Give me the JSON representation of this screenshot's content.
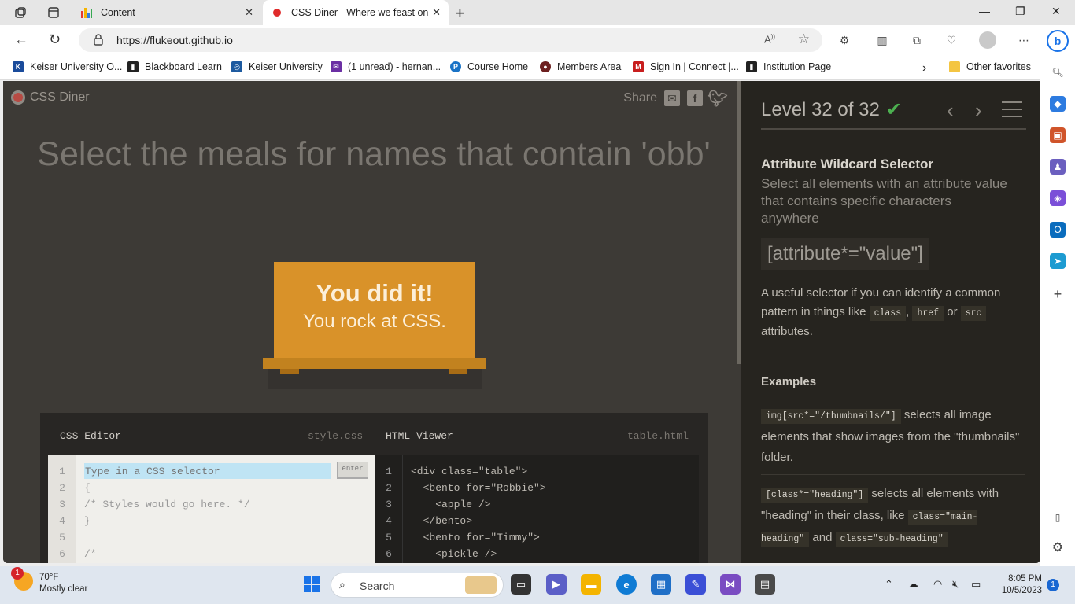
{
  "browser": {
    "tabs": [
      {
        "title": "Content",
        "active": false
      },
      {
        "title": "CSS Diner - Where we feast on CSS",
        "active": true
      }
    ],
    "url": "https://flukeout.github.io",
    "read_aloud": "A⁰",
    "favorites": [
      {
        "label": "Keiser University O...",
        "color": "#1a4b9b"
      },
      {
        "label": "Blackboard Learn",
        "color": "#222222"
      },
      {
        "label": "Keiser University",
        "color": "#1d5a9f"
      },
      {
        "label": "(1 unread) - hernan...",
        "color": "#6b2fa3"
      },
      {
        "label": "Course Home",
        "color": "#1a73c6"
      },
      {
        "label": "Members Area",
        "color": "#6d1f1f"
      },
      {
        "label": "Sign In | Connect |...",
        "color": "#c81e1e"
      },
      {
        "label": "Institution Page",
        "color": "#222222"
      }
    ],
    "other_favorites": "Other favorites"
  },
  "game": {
    "logo": "CSS Diner",
    "share": "Share",
    "instruction": "Select the meals for names that contain 'obb'",
    "win_line1": "You did it!",
    "win_line2": "You rock at CSS."
  },
  "editor": {
    "css_title": "CSS Editor",
    "css_file": "style.css",
    "html_title": "HTML Viewer",
    "html_file": "table.html",
    "placeholder": "Type in a CSS selector",
    "enter": "enter",
    "css_lines": [
      "{",
      "/* Styles would go here. */",
      "}",
      "",
      "/*"
    ],
    "line_numbers": [
      "1",
      "2",
      "3",
      "4",
      "5",
      "6"
    ],
    "html_lines": [
      "<div class=\"table\">",
      "  <bento for=\"Robbie\">",
      "    <apple />",
      "  </bento>",
      "  <bento for=\"Timmy\">",
      "    <pickle />"
    ]
  },
  "sidebar": {
    "level": "Level 32 of 32",
    "check": "✔",
    "selector_name": "Attribute Wildcard Selector",
    "selector_title": "Select all elements with an attribute value that contains specific characters anywhere",
    "syntax": "[attribute*=\"value\"]",
    "hint_pre": "A useful selector if you can identify a common pattern in things like",
    "hint_code1": "class",
    "hint_comma": ",",
    "hint_code2": "href",
    "hint_or": "or",
    "hint_code3": "src",
    "hint_post": "attributes.",
    "examples_heading": "Examples",
    "example1_code": "img[src*=\"/thumbnails/\"]",
    "example1_text": "selects all image elements that show images from the \"thumbnails\" folder.",
    "example2_code": "[class*=\"heading\"]",
    "example2_text": "selects all elements with \"heading\" in their class, like",
    "example2_code2": "class=\"main-heading\"",
    "example2_and": "and",
    "example2_code3": "class=\"sub-heading\""
  },
  "taskbar": {
    "weather_temp": "70°F",
    "weather_desc": "Mostly clear",
    "weather_badge": "1",
    "search": "Search",
    "time": "8:05 PM",
    "date": "10/5/2023",
    "notifications": "1"
  }
}
